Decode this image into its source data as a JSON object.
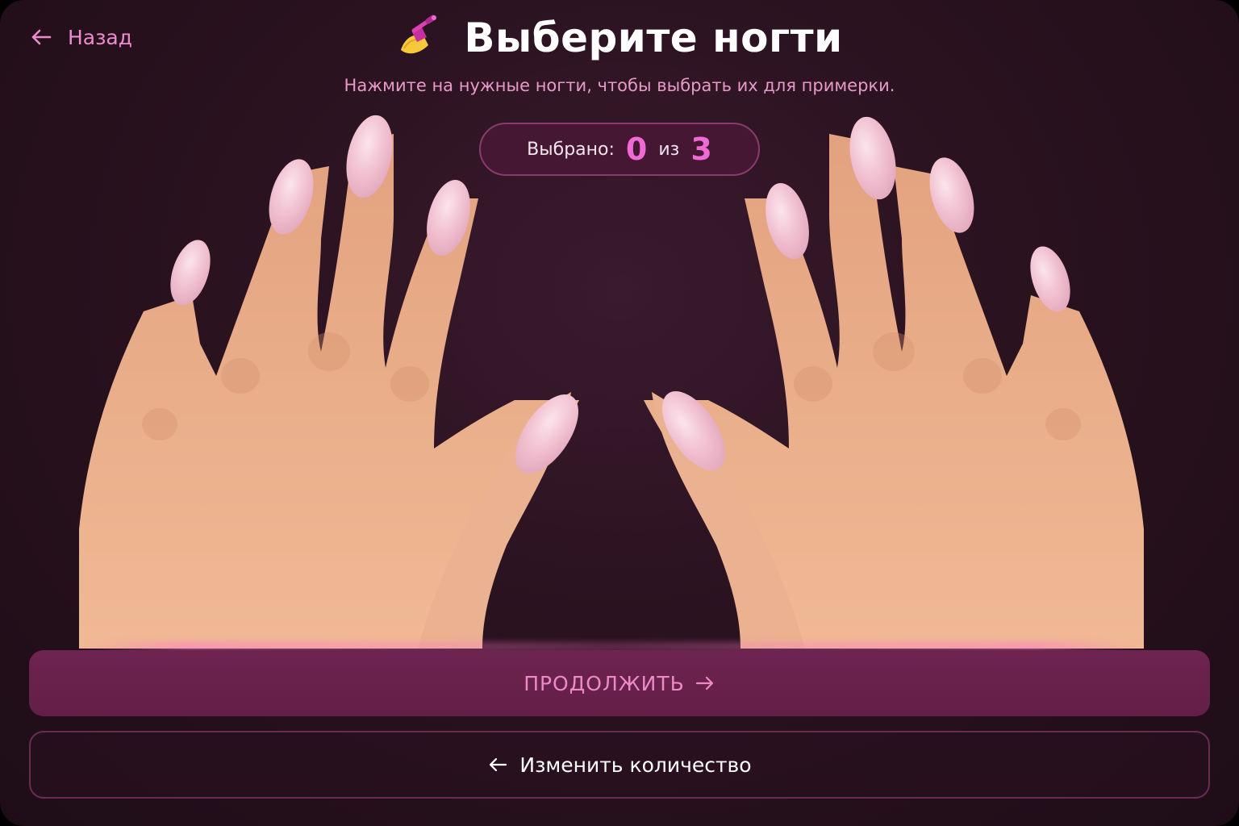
{
  "header": {
    "back_label": "Назад",
    "title": "Выберите ногти",
    "subtitle": "Нажмите на нужные ногти, чтобы выбрать их для примерки."
  },
  "counter": {
    "label": "Выбрано:",
    "selected": "0",
    "separator": "из",
    "total": "3"
  },
  "actions": {
    "continue_label": "ПРОДОЛЖИТЬ",
    "change_label": "Изменить количество"
  },
  "icons": {
    "back": "arrow-left-icon",
    "title": "nail-polish-icon",
    "continue": "arrow-right-icon",
    "change": "arrow-left-icon"
  },
  "colors": {
    "accent": "#f06ad6",
    "nail": "#f2c3d3",
    "skin": "#e8aa88",
    "button_primary": "#6a2250",
    "background": "#2a121f"
  }
}
